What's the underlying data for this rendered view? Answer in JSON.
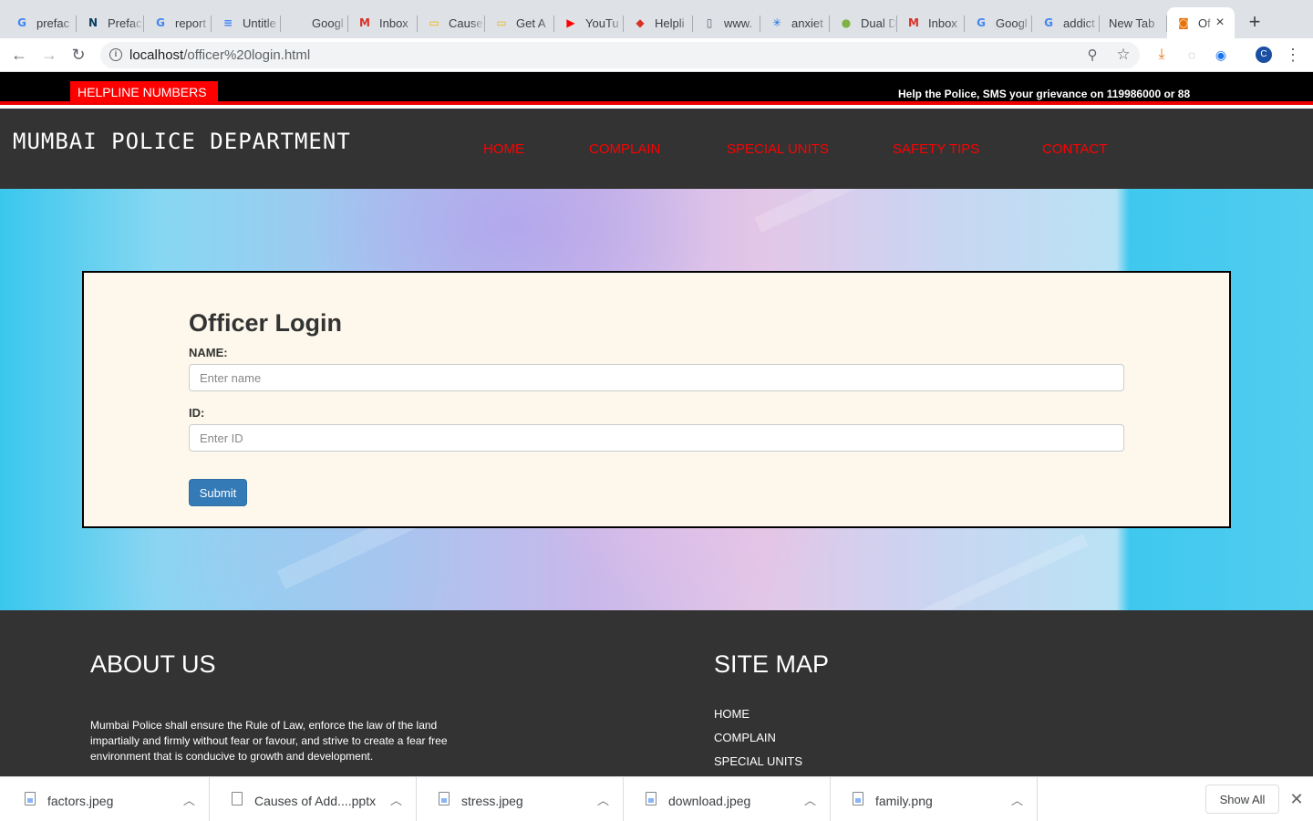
{
  "browser": {
    "tabs": [
      {
        "title": "prefac",
        "icon": "google-icon",
        "glyph": "G",
        "color": "#4285f4"
      },
      {
        "title": "Prefac",
        "icon": "n-logo-icon",
        "glyph": "N",
        "color": "#0a3d62"
      },
      {
        "title": "report",
        "icon": "google-icon",
        "glyph": "G",
        "color": "#4285f4"
      },
      {
        "title": "Untitle",
        "icon": "docs-icon",
        "glyph": "≡",
        "color": "#4285f4"
      },
      {
        "title": "Googl",
        "icon": "blank-icon",
        "glyph": "",
        "color": "#dee1e6"
      },
      {
        "title": "Inbox",
        "icon": "gmail-icon",
        "glyph": "M",
        "color": "#d93025"
      },
      {
        "title": "Cause",
        "icon": "slides-icon",
        "glyph": "▭",
        "color": "#f4b400"
      },
      {
        "title": "Get A",
        "icon": "slides-icon",
        "glyph": "▭",
        "color": "#f4b400"
      },
      {
        "title": "YouTu",
        "icon": "youtube-icon",
        "glyph": "▶",
        "color": "#ff0000"
      },
      {
        "title": "Helpli",
        "icon": "helpline-icon",
        "glyph": "◆",
        "color": "#d93025"
      },
      {
        "title": "www.",
        "icon": "page-icon",
        "glyph": "▯",
        "color": "#5f6368"
      },
      {
        "title": "anxiet",
        "icon": "app-icon",
        "glyph": "✳",
        "color": "#1a73e8"
      },
      {
        "title": "Dual D",
        "icon": "leaf-icon",
        "glyph": "●",
        "color": "#7cb342"
      },
      {
        "title": "Inbox",
        "icon": "gmail-icon",
        "glyph": "M",
        "color": "#d93025"
      },
      {
        "title": "Googl",
        "icon": "google-icon",
        "glyph": "G",
        "color": "#4285f4"
      },
      {
        "title": "addict",
        "icon": "google-icon",
        "glyph": "G",
        "color": "#4285f4"
      },
      {
        "title": "New Tab",
        "icon": "none",
        "glyph": "",
        "color": "#dee1e6"
      },
      {
        "title": "Of",
        "icon": "site-icon",
        "glyph": "◙",
        "color": "#e8710a",
        "active": true
      }
    ],
    "url_host": "localhost",
    "url_path": "/officer%20login.html"
  },
  "topbar": {
    "helpline_label": "HELPLINE NUMBERS",
    "marquee_text": "Help the Police, SMS your grievance on 119986000 or 88"
  },
  "header": {
    "brand": "MUMBAI POLICE DEPARTMENT",
    "nav": [
      "HOME",
      "COMPLAIN",
      "SPECIAL UNITS",
      "SAFETY TIPS",
      "CONTACT"
    ]
  },
  "login": {
    "title": "Officer Login",
    "name_label": "NAME:",
    "name_placeholder": "Enter name",
    "id_label": "ID:",
    "id_placeholder": "Enter ID",
    "submit_label": "Submit"
  },
  "footer": {
    "about_title": "ABOUT US",
    "about_text": "Mumbai Police shall ensure the Rule of Law, enforce the law of the land impartially and firmly without fear or favour, and strive to create a fear free environment that is conducive to growth and development.",
    "sitemap_title": "SITE MAP",
    "sitemap_links": [
      "HOME",
      "COMPLAIN",
      "SPECIAL UNITS"
    ]
  },
  "downloads": {
    "items": [
      {
        "name": "factors.jpeg",
        "type": "image"
      },
      {
        "name": "Causes of Add....pptx",
        "type": "file"
      },
      {
        "name": "stress.jpeg",
        "type": "image"
      },
      {
        "name": "download.jpeg",
        "type": "image"
      },
      {
        "name": "family.png",
        "type": "image"
      }
    ],
    "show_all_label": "Show All"
  },
  "profile_initial": "C",
  "colors": {
    "nav_red": "#ff0000",
    "header_bg": "#333333",
    "card_bg": "#fdf8eb",
    "submit_blue": "#337ab7"
  }
}
